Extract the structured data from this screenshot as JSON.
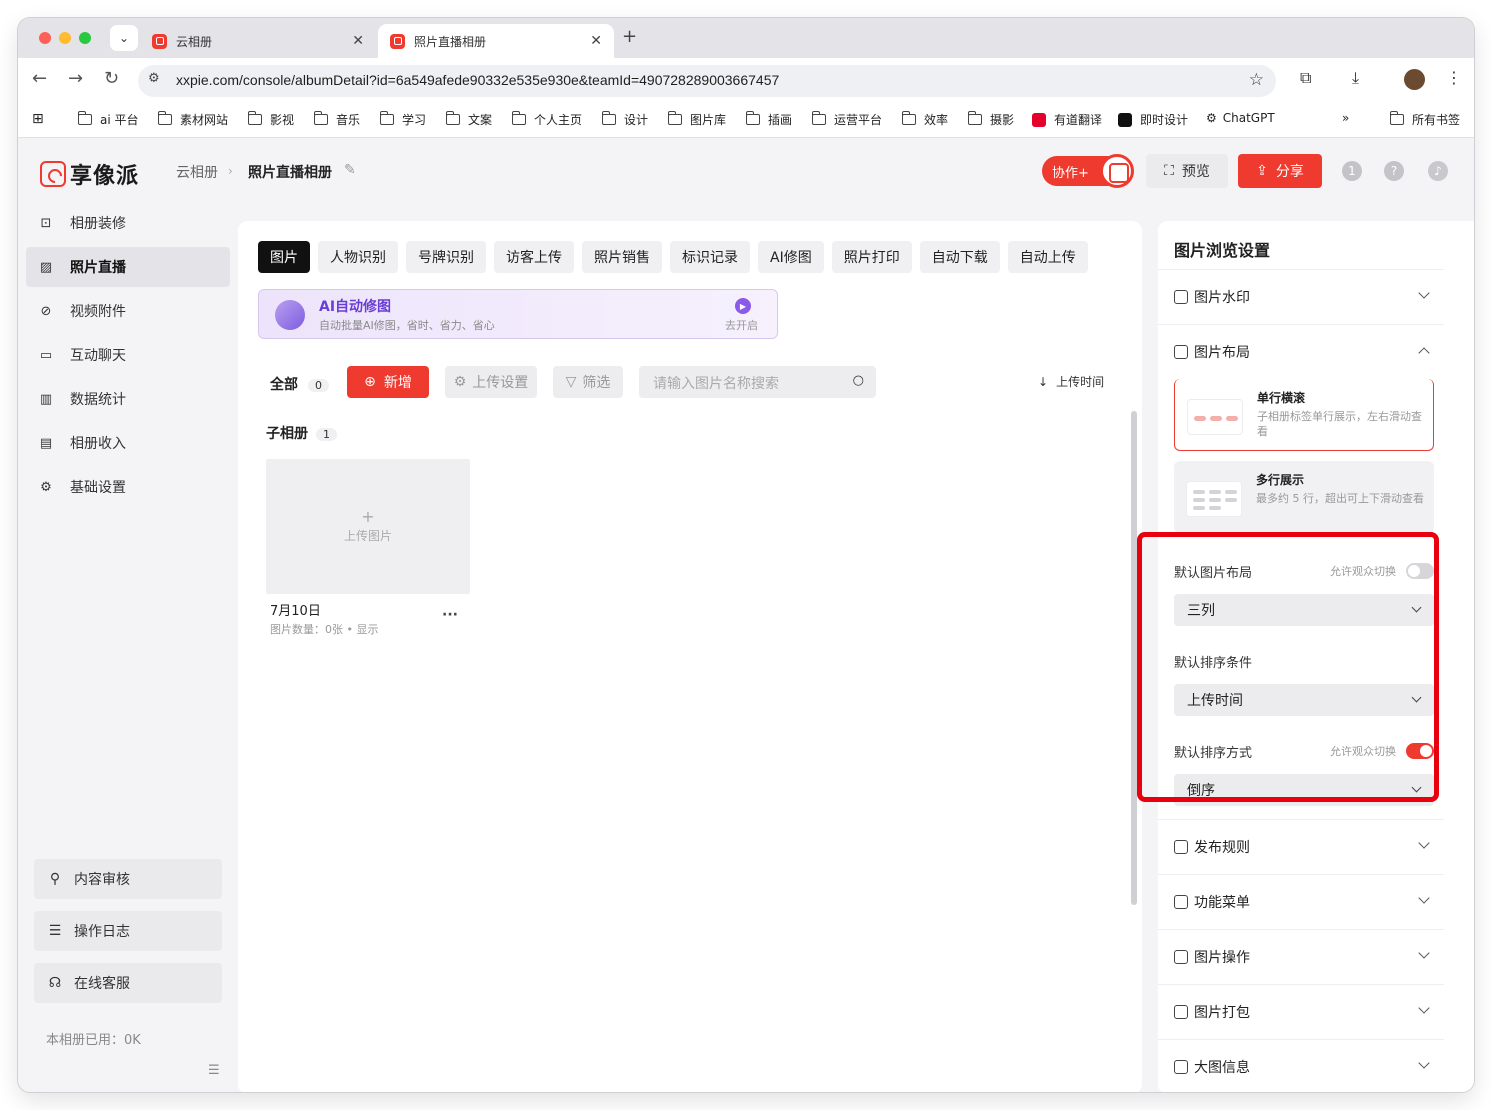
{
  "browser": {
    "tabs": [
      {
        "title": "云相册",
        "active": false
      },
      {
        "title": "照片直播相册",
        "active": true
      }
    ],
    "url": "xxpie.com/console/albumDetail?id=6a549afede90332e535e930e&teamId=490728289003667457",
    "bookmarks": [
      "ai 平台",
      "素材网站",
      "影视",
      "音乐",
      "学习",
      "文案",
      "个人主页",
      "设计",
      "图片库",
      "插画",
      "运营平台",
      "效率",
      "摄影",
      "有道翻译",
      "即时设计",
      "ChatGPT",
      "所有书签"
    ],
    "more": "»"
  },
  "header": {
    "logo": "享像派",
    "breadcrumb_root": "云相册",
    "breadcrumb_current": "照片直播相册",
    "collab": "协作+",
    "preview": "预览",
    "share": "分享"
  },
  "sidebar": {
    "items": [
      {
        "label": "相册装修"
      },
      {
        "label": "照片直播"
      },
      {
        "label": "视频附件"
      },
      {
        "label": "互动聊天"
      },
      {
        "label": "数据统计"
      },
      {
        "label": "相册收入"
      },
      {
        "label": "基础设置"
      }
    ],
    "bottom": [
      "内容审核",
      "操作日志",
      "在线客服"
    ],
    "usage": "本相册已用：0K"
  },
  "main": {
    "tabs": [
      "图片",
      "人物识别",
      "号牌识别",
      "访客上传",
      "照片销售",
      "标识记录",
      "AI修图",
      "照片打印",
      "自动下载",
      "自动上传"
    ],
    "ai_banner": {
      "title": "AI自动修图",
      "desc": "自动批量AI修图，省时、省力、省心",
      "action": "去开启"
    },
    "all_label": "全部",
    "all_count": "0",
    "add": "新增",
    "upload_settings": "上传设置",
    "filter": "筛选",
    "search_placeholder": "请输入图片名称搜索",
    "sort": "上传时间",
    "sub_album_label": "子相册",
    "sub_album_count": "1",
    "album": {
      "upload": "上传图片",
      "date": "7月10日",
      "meta": "图片数量：0张 • 显示",
      "more": "···"
    }
  },
  "settings": {
    "title": "图片浏览设置",
    "watermark": "图片水印",
    "layout": "图片布局",
    "layout_options": [
      {
        "title": "单行横滚",
        "desc": "子相册标签单行展示，左右滑动查看"
      },
      {
        "title": "多行展示",
        "desc": "最多约 5 行，超出可上下滑动查看"
      }
    ],
    "default_layout_label": "默认图片布局",
    "allow_switch": "允许观众切换",
    "default_layout_value": "三列",
    "default_sort_cond_label": "默认排序条件",
    "default_sort_cond_value": "上传时间",
    "default_sort_order_label": "默认排序方式",
    "default_sort_order_value": "倒序",
    "allow_layout_switch_on": false,
    "allow_order_switch_on": true,
    "sections": [
      "发布规则",
      "功能菜单",
      "图片操作",
      "图片打包",
      "大图信息"
    ]
  }
}
